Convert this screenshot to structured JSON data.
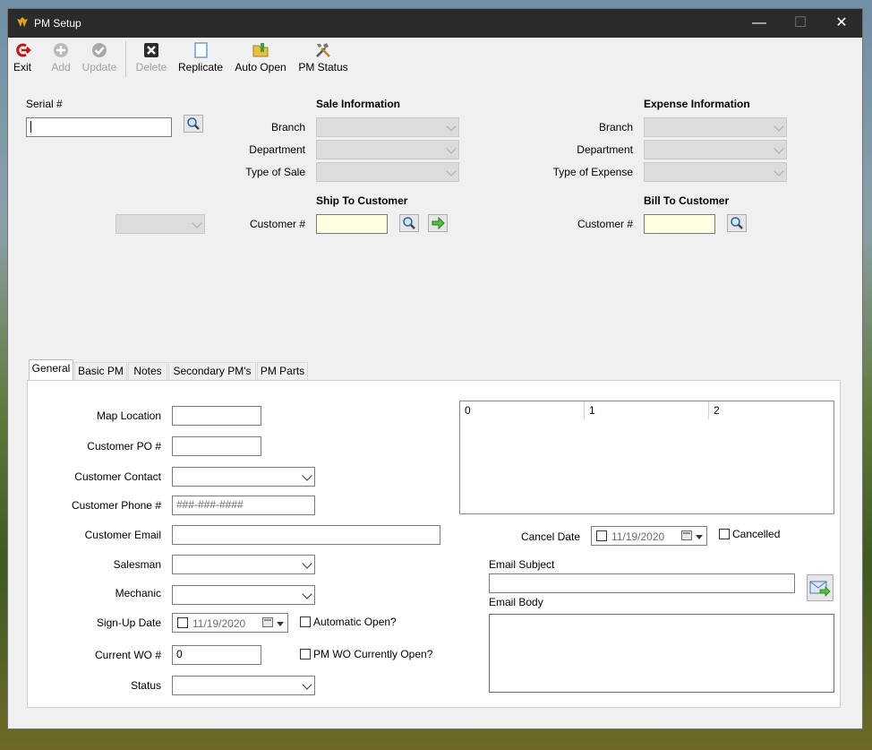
{
  "window": {
    "title": "PM Setup"
  },
  "toolbar": {
    "exit": "Exit",
    "add": "Add",
    "update": "Update",
    "delete": "Delete",
    "replicate": "Replicate",
    "auto_open": "Auto Open",
    "pm_status": "PM Status"
  },
  "serial": {
    "label": "Serial #",
    "value": ""
  },
  "sale": {
    "heading": "Sale Information",
    "branch_label": "Branch",
    "department_label": "Department",
    "type_label": "Type of Sale",
    "ship_heading": "Ship To Customer",
    "customer_label": "Customer #",
    "customer_value": ""
  },
  "expense": {
    "heading": "Expense Information",
    "branch_label": "Branch",
    "department_label": "Department",
    "type_label": "Type of Expense",
    "bill_heading": "Bill To Customer",
    "customer_label": "Customer #",
    "customer_value": ""
  },
  "tabs": [
    {
      "label": "General",
      "active": true
    },
    {
      "label": "Basic PM"
    },
    {
      "label": "Notes"
    },
    {
      "label": "Secondary PM's"
    },
    {
      "label": "PM Parts"
    }
  ],
  "general": {
    "map_location": {
      "label": "Map Location",
      "value": ""
    },
    "customer_po": {
      "label": "Customer PO #",
      "value": ""
    },
    "customer_contact": {
      "label": "Customer Contact",
      "value": ""
    },
    "customer_phone": {
      "label": "Customer Phone #",
      "placeholder": "###-###-####"
    },
    "customer_email": {
      "label": "Customer Email",
      "value": ""
    },
    "salesman": {
      "label": "Salesman",
      "value": ""
    },
    "mechanic": {
      "label": "Mechanic",
      "value": ""
    },
    "signup_date": {
      "label": "Sign-Up Date",
      "value": "11/19/2020"
    },
    "automatic_open": {
      "label": "Automatic Open?",
      "checked": false
    },
    "current_wo": {
      "label": "Current WO #",
      "value": "0"
    },
    "pm_wo_open": {
      "label": "PM WO Currently Open?",
      "checked": false
    },
    "status": {
      "label": "Status",
      "value": ""
    },
    "grid_columns": [
      "0",
      "1",
      "2"
    ],
    "cancel_date": {
      "label": "Cancel Date",
      "value": "11/19/2020"
    },
    "cancelled": {
      "label": "Cancelled",
      "checked": false
    },
    "email_subject": {
      "label": "Email Subject",
      "value": ""
    },
    "email_body": {
      "label": "Email Body",
      "value": ""
    }
  },
  "colors": {
    "titlebar": "#2b2b2b",
    "window": "#f0f0f0",
    "highlight_input": "#ffffe1",
    "panel": "#ffffff"
  },
  "icons": {
    "exit": "exit-arrow-icon",
    "add": "plus-circle-icon",
    "update": "check-circle-icon",
    "delete": "delete-x-icon",
    "replicate": "document-icon",
    "auto_open": "folder-auto-icon",
    "pm_status": "tools-icon",
    "lookup": "magnifier-icon",
    "go": "green-arrow-icon",
    "email_send": "envelope-arrow-icon"
  }
}
